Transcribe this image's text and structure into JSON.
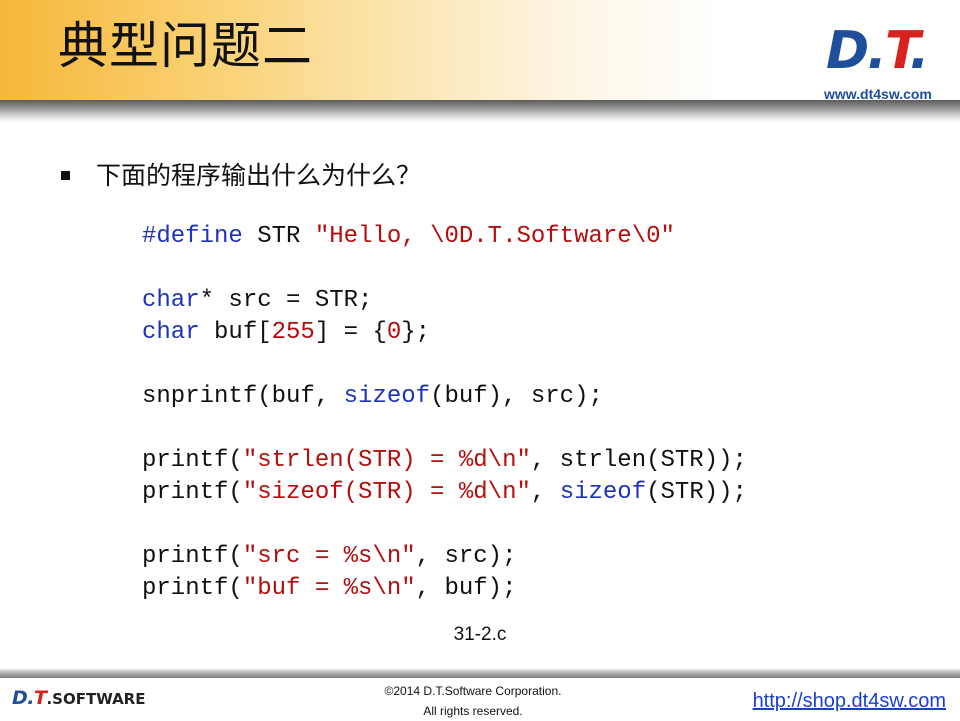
{
  "header": {
    "title": "典型问题二",
    "logo": {
      "d": "D",
      "dot": ".",
      "t": "T",
      "period": "."
    },
    "logo_url": "www.dt4sw.com"
  },
  "content": {
    "question": "下面的程序输出什么为什么？",
    "code_lines": [
      [
        {
          "t": "#define",
          "c": "kw"
        },
        {
          "t": " STR ",
          "c": ""
        },
        {
          "t": "\"Hello, \\0D.T.Software\\0\"",
          "c": "str"
        }
      ],
      [],
      [
        {
          "t": "char",
          "c": "kw"
        },
        {
          "t": "* src = STR;",
          "c": ""
        }
      ],
      [
        {
          "t": "char",
          "c": "kw"
        },
        {
          "t": " buf[",
          "c": ""
        },
        {
          "t": "255",
          "c": "num"
        },
        {
          "t": "] = {",
          "c": ""
        },
        {
          "t": "0",
          "c": "num"
        },
        {
          "t": "};",
          "c": ""
        }
      ],
      [],
      [
        {
          "t": "snprintf(buf, ",
          "c": ""
        },
        {
          "t": "sizeof",
          "c": "kw"
        },
        {
          "t": "(buf), src);",
          "c": ""
        }
      ],
      [],
      [
        {
          "t": "printf(",
          "c": ""
        },
        {
          "t": "\"strlen(STR) = %d\\n\"",
          "c": "str"
        },
        {
          "t": ", strlen(STR));",
          "c": ""
        }
      ],
      [
        {
          "t": "printf(",
          "c": ""
        },
        {
          "t": "\"sizeof(STR) = %d\\n\"",
          "c": "str"
        },
        {
          "t": ", ",
          "c": ""
        },
        {
          "t": "sizeof",
          "c": "kw"
        },
        {
          "t": "(STR));",
          "c": ""
        }
      ],
      [],
      [
        {
          "t": "printf(",
          "c": ""
        },
        {
          "t": "\"src = %s\\n\"",
          "c": "str"
        },
        {
          "t": ", src);",
          "c": ""
        }
      ],
      [
        {
          "t": "printf(",
          "c": ""
        },
        {
          "t": "\"buf = %s\\n\"",
          "c": "str"
        },
        {
          "t": ", buf);",
          "c": ""
        }
      ]
    ],
    "caption": "31-2.c"
  },
  "footer": {
    "logo": {
      "d": "D.",
      "t": "T",
      "rest": ".SOFTWARE"
    },
    "copyright_line1": "©2014 D.T.Software Corporation.",
    "copyright_line2": "All rights reserved.",
    "link": "http://shop.dt4sw.com"
  },
  "colors": {
    "keyword": "#1f33b5",
    "string": "#b30d0d",
    "header_gold": "#f6b73a",
    "logo_blue": "#1f4e9a",
    "logo_red": "#d7231f",
    "link": "#1a3fd0"
  }
}
